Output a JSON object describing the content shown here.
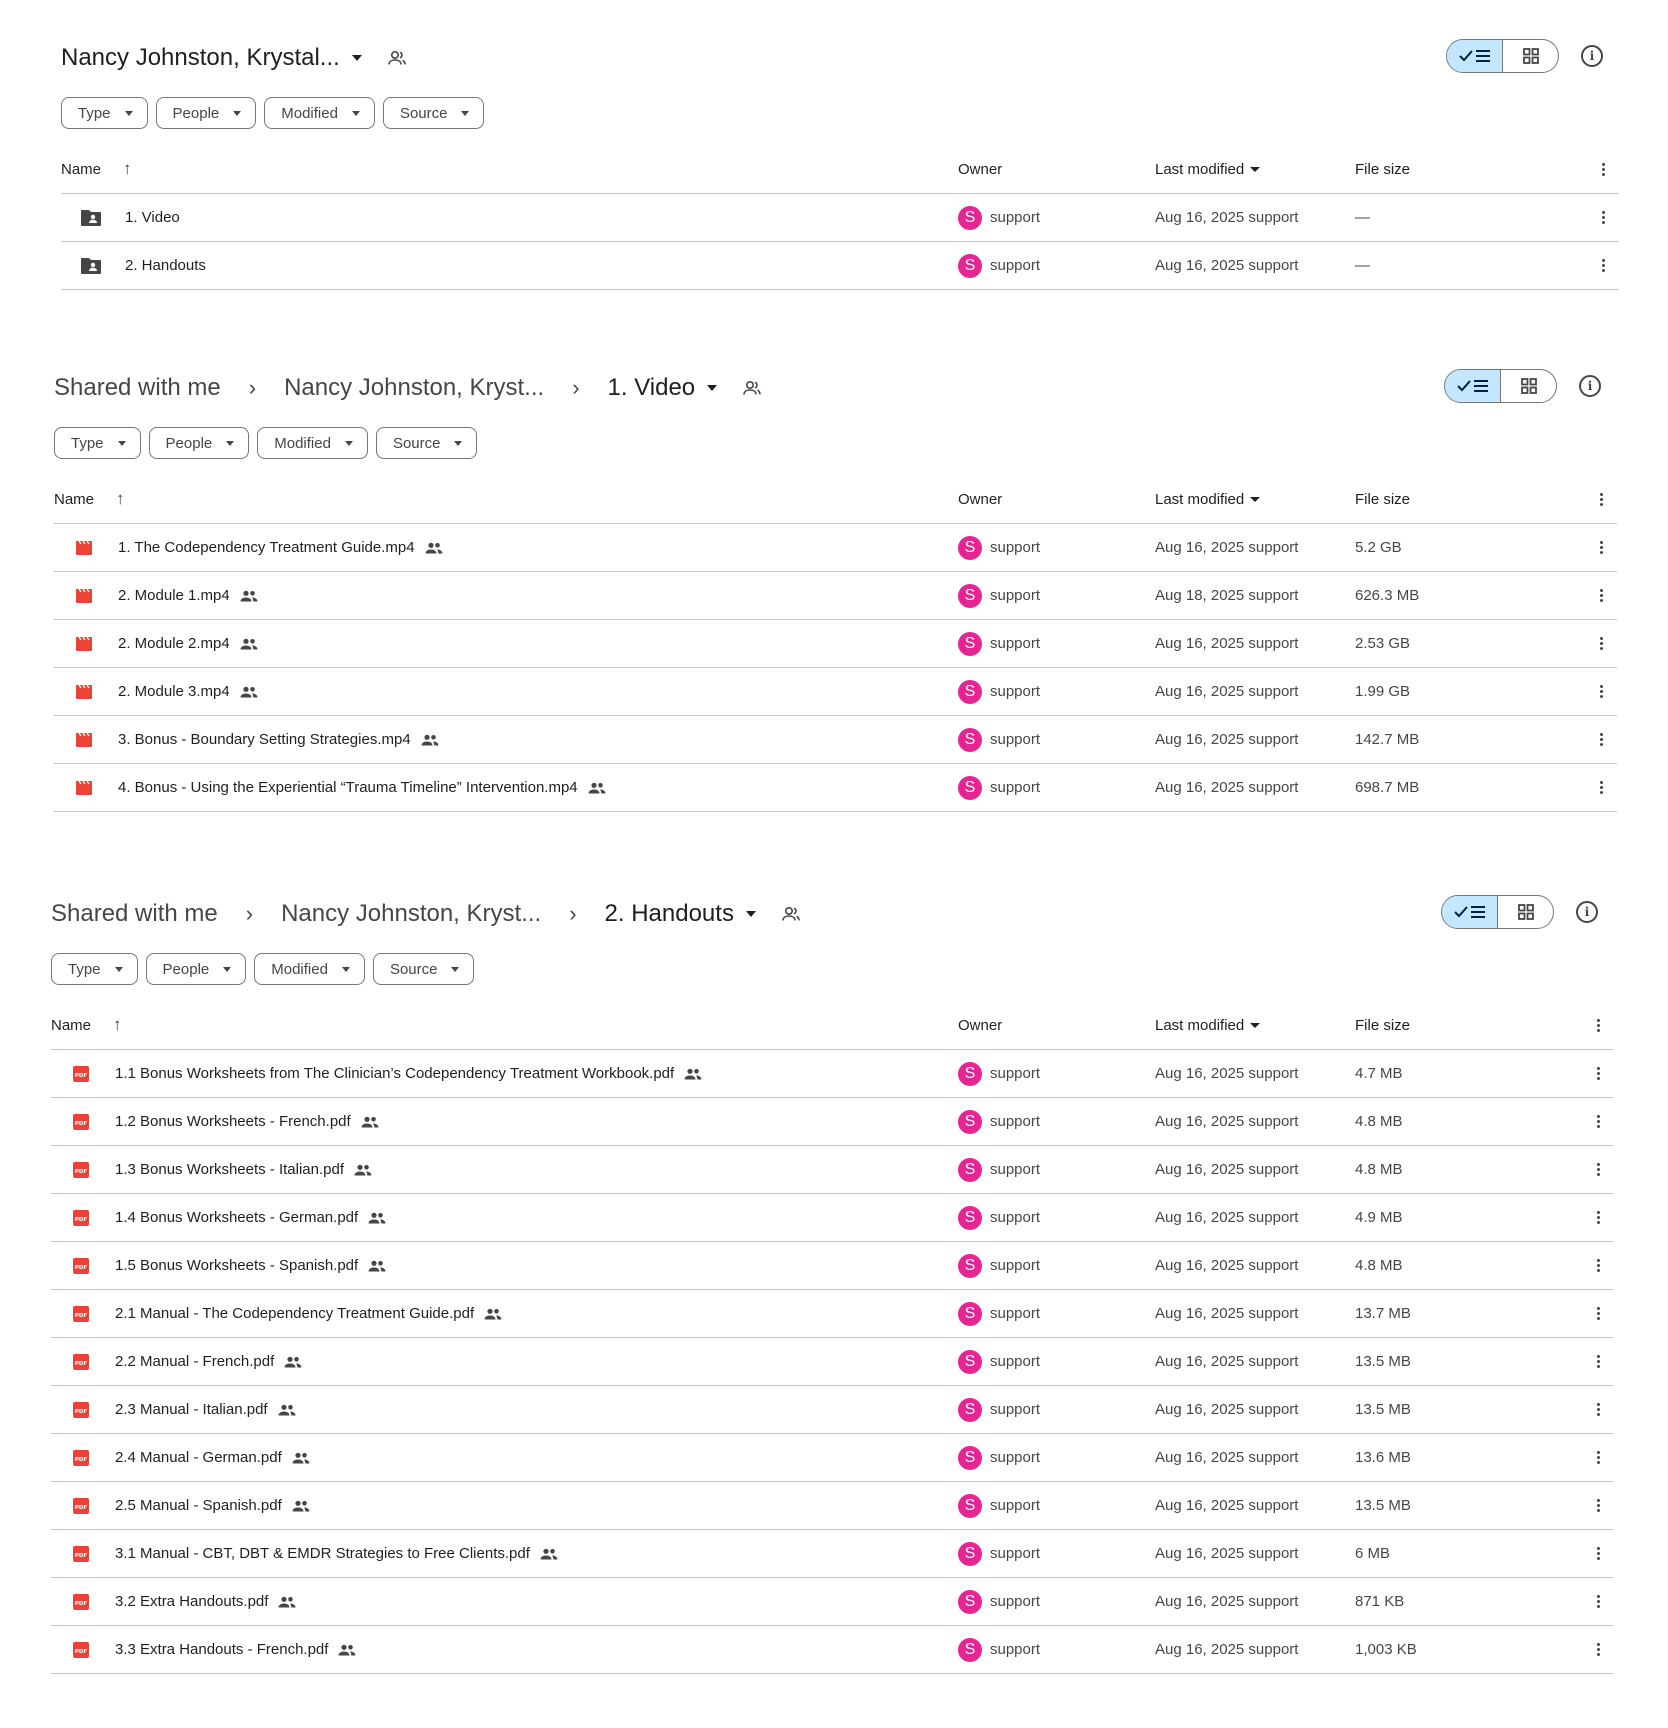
{
  "icons": {
    "folder": "shared-folder-icon",
    "video": "video-file-icon",
    "pdf": "pdf-file-icon",
    "people": "shared-people-icon",
    "list_view": "list-view-icon",
    "grid_view": "grid-view-icon",
    "info": "info-icon",
    "more": "more-vert-icon",
    "sort": "arrow-up-icon"
  },
  "colors": {
    "avatar": "#e52592",
    "toggle_active": "#c2e7ff",
    "video": "#ea4335",
    "pdf": "#ea4335",
    "folder": "#444746"
  },
  "filters": [
    "Type",
    "People",
    "Modified",
    "Source"
  ],
  "columns": {
    "name": "Name",
    "owner": "Owner",
    "modified": "Last modified",
    "size": "File size"
  },
  "owner_initial": "S",
  "panels": [
    {
      "crumbs": [],
      "current": "Nancy Johnston, Krystal...",
      "rows": [
        {
          "name": "1. Video",
          "type": "folder",
          "shared": false,
          "owner": "support",
          "modified": "Aug 16, 2025 support",
          "size": "—"
        },
        {
          "name": "2. Handouts",
          "type": "folder",
          "shared": false,
          "owner": "support",
          "modified": "Aug 16, 2025 support",
          "size": "—"
        }
      ]
    },
    {
      "crumbs": [
        "Shared with me",
        "Nancy Johnston, Kryst..."
      ],
      "current": "1. Video",
      "rows": [
        {
          "name": "1. The Codependency Treatment Guide.mp4",
          "type": "video",
          "shared": true,
          "owner": "support",
          "modified": "Aug 16, 2025 support",
          "size": "5.2 GB"
        },
        {
          "name": "2. Module 1.mp4",
          "type": "video",
          "shared": true,
          "owner": "support",
          "modified": "Aug 18, 2025 support",
          "size": "626.3 MB"
        },
        {
          "name": "2. Module 2.mp4",
          "type": "video",
          "shared": true,
          "owner": "support",
          "modified": "Aug 16, 2025 support",
          "size": "2.53 GB"
        },
        {
          "name": "2. Module 3.mp4",
          "type": "video",
          "shared": true,
          "owner": "support",
          "modified": "Aug 16, 2025 support",
          "size": "1.99 GB"
        },
        {
          "name": "3. Bonus - Boundary Setting Strategies.mp4",
          "type": "video",
          "shared": true,
          "owner": "support",
          "modified": "Aug 16, 2025 support",
          "size": "142.7 MB"
        },
        {
          "name": "4. Bonus - Using the Experiential “Trauma Timeline” Intervention.mp4",
          "type": "video",
          "shared": true,
          "owner": "support",
          "modified": "Aug 16, 2025 support",
          "size": "698.7 MB"
        }
      ]
    },
    {
      "crumbs": [
        "Shared with me",
        "Nancy Johnston, Kryst..."
      ],
      "current": "2. Handouts",
      "rows": [
        {
          "name": "1.1 Bonus Worksheets from The Clinician’s Codependency Treatment Workbook.pdf",
          "type": "pdf",
          "shared": true,
          "owner": "support",
          "modified": "Aug 16, 2025 support",
          "size": "4.7 MB"
        },
        {
          "name": "1.2 Bonus Worksheets - French.pdf",
          "type": "pdf",
          "shared": true,
          "owner": "support",
          "modified": "Aug 16, 2025 support",
          "size": "4.8 MB"
        },
        {
          "name": "1.3 Bonus Worksheets - Italian.pdf",
          "type": "pdf",
          "shared": true,
          "owner": "support",
          "modified": "Aug 16, 2025 support",
          "size": "4.8 MB"
        },
        {
          "name": "1.4 Bonus Worksheets - German.pdf",
          "type": "pdf",
          "shared": true,
          "owner": "support",
          "modified": "Aug 16, 2025 support",
          "size": "4.9 MB"
        },
        {
          "name": "1.5 Bonus Worksheets - Spanish.pdf",
          "type": "pdf",
          "shared": true,
          "owner": "support",
          "modified": "Aug 16, 2025 support",
          "size": "4.8 MB"
        },
        {
          "name": "2.1 Manual - The Codependency Treatment Guide.pdf",
          "type": "pdf",
          "shared": true,
          "owner": "support",
          "modified": "Aug 16, 2025 support",
          "size": "13.7 MB"
        },
        {
          "name": "2.2 Manual - French.pdf",
          "type": "pdf",
          "shared": true,
          "owner": "support",
          "modified": "Aug 16, 2025 support",
          "size": "13.5 MB"
        },
        {
          "name": "2.3 Manual - Italian.pdf",
          "type": "pdf",
          "shared": true,
          "owner": "support",
          "modified": "Aug 16, 2025 support",
          "size": "13.5 MB"
        },
        {
          "name": "2.4 Manual - German.pdf",
          "type": "pdf",
          "shared": true,
          "owner": "support",
          "modified": "Aug 16, 2025 support",
          "size": "13.6 MB"
        },
        {
          "name": "2.5 Manual - Spanish.pdf",
          "type": "pdf",
          "shared": true,
          "owner": "support",
          "modified": "Aug 16, 2025 support",
          "size": "13.5 MB"
        },
        {
          "name": "3.1 Manual - CBT, DBT & EMDR Strategies to Free Clients.pdf",
          "type": "pdf",
          "shared": true,
          "owner": "support",
          "modified": "Aug 16, 2025 support",
          "size": "6 MB"
        },
        {
          "name": "3.2 Extra Handouts.pdf",
          "type": "pdf",
          "shared": true,
          "owner": "support",
          "modified": "Aug 16, 2025 support",
          "size": "871 KB"
        },
        {
          "name": "3.3 Extra Handouts - French.pdf",
          "type": "pdf",
          "shared": true,
          "owner": "support",
          "modified": "Aug 16, 2025 support",
          "size": "1,003 KB"
        }
      ]
    }
  ]
}
